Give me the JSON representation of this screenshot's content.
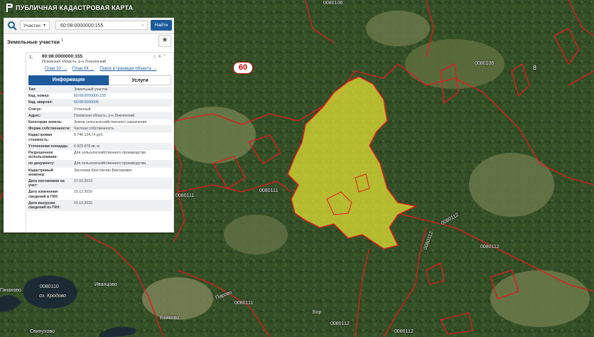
{
  "app": {
    "title": "ПУБЛИЧНАЯ КАДАСТРОВАЯ КАРТА"
  },
  "search": {
    "type_label": "Участки",
    "query": "60:08:0000000:155",
    "find_label": "Найти"
  },
  "section": {
    "title": "Земельные участки",
    "count": "1"
  },
  "result": {
    "index": "1.",
    "cad_number": "60:08:0000000:155",
    "address_short": "Псковская область, р-н Локнянский",
    "links": [
      "План ЗУ →",
      "План КК →",
      "Поиск в границах объекта →"
    ]
  },
  "tabs": {
    "info": "Информация",
    "services": "Услуги"
  },
  "attributes": [
    {
      "k": "Тип:",
      "v": "Земельный участок"
    },
    {
      "k": "Кад. номер:",
      "v": "60:08:0000000:155",
      "link": true
    },
    {
      "k": "Кад. квартал:",
      "v": "60:08:0000000",
      "link": true
    },
    {
      "k": "Статус:",
      "v": "Учтенный"
    },
    {
      "k": "Адрес:",
      "v": "Псковская область, р-н Локнянский"
    },
    {
      "k": "Категория земель:",
      "v": "Земли сельскохозяйственного назначения"
    },
    {
      "k": "Форма собственности:",
      "v": "Частная собственность"
    },
    {
      "k": "Кадастровая стоимость:",
      "v": "5 746 134,74 руб."
    },
    {
      "k": "Уточненная площадь:",
      "v": "6 923 078 кв. м"
    },
    {
      "k": "Разрешенное использование:",
      "v": "Для сельскохозяйственного производства"
    },
    {
      "k": "по документу:",
      "v": "Для сельскохозяйственного производства"
    },
    {
      "k": "Кадастровый инженер:",
      "v": "Заслонов Константин Викторович"
    },
    {
      "k": "Дата постановки на учет:",
      "v": "17.10.2013"
    },
    {
      "k": "Дата изменения сведений в ГКН:",
      "v": "15.12.2016"
    },
    {
      "k": "Дата выгрузки сведений из ГКН:",
      "v": "15.12.2016"
    }
  ],
  "map_labels": {
    "road": "60",
    "q1": "0080106",
    "q2": "0080106",
    "q3": "0080111",
    "q4": "0080112",
    "q5": "0080110",
    "q6": "0080111",
    "q7": "0080112",
    "q8": "0080112",
    "q9": "0080112",
    "lake": "оз. Кродово",
    "v1": "Иванцово",
    "v2": "Байково",
    "v3": "Свинухово",
    "v4": "Ганахово",
    "v5": "Пирово",
    "v6": "Бор",
    "digit8": "8",
    "q10": "0080111",
    "q11": "0080112"
  },
  "colors": {
    "accent": "#1d5b9c",
    "parcel_highlight": "#e8e533",
    "boundary": "#e31a1c"
  }
}
